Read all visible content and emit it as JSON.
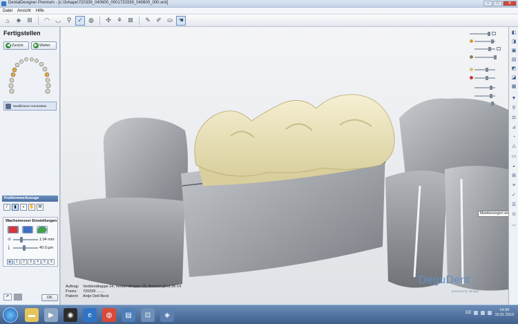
{
  "window": {
    "title": "DentalDesigner Premium - [c:\\3shape\\720339_040600_0001720339_040600_000.xml]",
    "minimize_glyph": "–",
    "maximize_glyph": "□",
    "close_glyph": "✕"
  },
  "menu": [
    "Datei",
    "Ansicht",
    "Hilfe"
  ],
  "left_panel": {
    "heading": "Fertigstellen",
    "back_label": "Zurück",
    "next_label": "Weiter",
    "modify_button_label": "Modifizieren Gerüstdesi",
    "freeform_title": "Freiformwerkzeuge",
    "wax_title": "Wachsmesser Einstellungen",
    "size_value": "1.04 mm",
    "depth_value": "40.0 µm",
    "number_buttons": [
      "1",
      "2",
      "3",
      "4",
      "5",
      "6"
    ],
    "ok_label": "OK"
  },
  "viewport": {
    "info": [
      {
        "key": "Auftrag:",
        "value": "Verblendkappe 24, Verblendkappe 25, Brückenglied 26-14"
      },
      {
        "key": "Praxis:",
        "value": "720339 ……"
      },
      {
        "key": "Patient:",
        "value": "Antje Dell-Beck"
      }
    ],
    "logo": "DeguDent",
    "logo_sub": "powered by 3shape",
    "tooltip": "Markierungen anzeigen"
  },
  "taskbar": {
    "language": "DE",
    "time": "14:34",
    "date": "10.01.2013"
  },
  "colors": {
    "accent": "#4a6fa3",
    "crown": "#efe6bf",
    "model": "#8f9297",
    "logo": "#5f8fc8"
  }
}
